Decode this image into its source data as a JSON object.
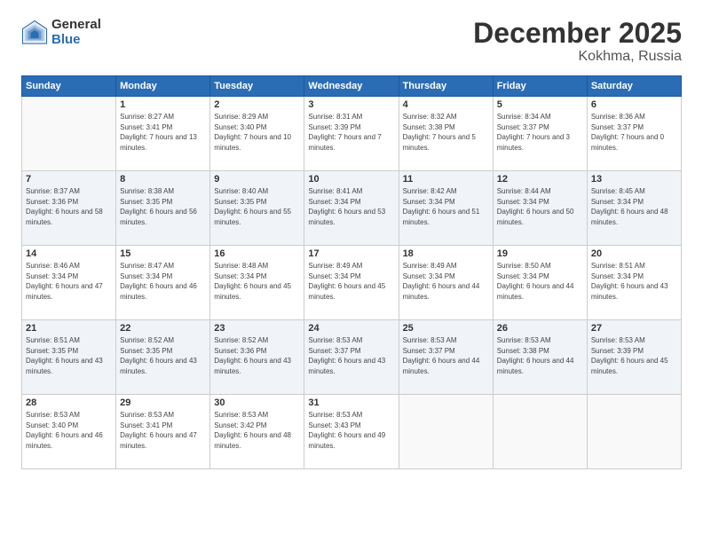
{
  "logo": {
    "general": "General",
    "blue": "Blue"
  },
  "title": "December 2025",
  "location": "Kokhma, Russia",
  "days_header": [
    "Sunday",
    "Monday",
    "Tuesday",
    "Wednesday",
    "Thursday",
    "Friday",
    "Saturday"
  ],
  "weeks": [
    [
      {
        "day": "",
        "sunrise": "",
        "sunset": "",
        "daylight": "",
        "empty": true
      },
      {
        "day": "1",
        "sunrise": "Sunrise: 8:27 AM",
        "sunset": "Sunset: 3:41 PM",
        "daylight": "Daylight: 7 hours and 13 minutes."
      },
      {
        "day": "2",
        "sunrise": "Sunrise: 8:29 AM",
        "sunset": "Sunset: 3:40 PM",
        "daylight": "Daylight: 7 hours and 10 minutes."
      },
      {
        "day": "3",
        "sunrise": "Sunrise: 8:31 AM",
        "sunset": "Sunset: 3:39 PM",
        "daylight": "Daylight: 7 hours and 7 minutes."
      },
      {
        "day": "4",
        "sunrise": "Sunrise: 8:32 AM",
        "sunset": "Sunset: 3:38 PM",
        "daylight": "Daylight: 7 hours and 5 minutes."
      },
      {
        "day": "5",
        "sunrise": "Sunrise: 8:34 AM",
        "sunset": "Sunset: 3:37 PM",
        "daylight": "Daylight: 7 hours and 3 minutes."
      },
      {
        "day": "6",
        "sunrise": "Sunrise: 8:36 AM",
        "sunset": "Sunset: 3:37 PM",
        "daylight": "Daylight: 7 hours and 0 minutes."
      }
    ],
    [
      {
        "day": "7",
        "sunrise": "Sunrise: 8:37 AM",
        "sunset": "Sunset: 3:36 PM",
        "daylight": "Daylight: 6 hours and 58 minutes."
      },
      {
        "day": "8",
        "sunrise": "Sunrise: 8:38 AM",
        "sunset": "Sunset: 3:35 PM",
        "daylight": "Daylight: 6 hours and 56 minutes."
      },
      {
        "day": "9",
        "sunrise": "Sunrise: 8:40 AM",
        "sunset": "Sunset: 3:35 PM",
        "daylight": "Daylight: 6 hours and 55 minutes."
      },
      {
        "day": "10",
        "sunrise": "Sunrise: 8:41 AM",
        "sunset": "Sunset: 3:34 PM",
        "daylight": "Daylight: 6 hours and 53 minutes."
      },
      {
        "day": "11",
        "sunrise": "Sunrise: 8:42 AM",
        "sunset": "Sunset: 3:34 PM",
        "daylight": "Daylight: 6 hours and 51 minutes."
      },
      {
        "day": "12",
        "sunrise": "Sunrise: 8:44 AM",
        "sunset": "Sunset: 3:34 PM",
        "daylight": "Daylight: 6 hours and 50 minutes."
      },
      {
        "day": "13",
        "sunrise": "Sunrise: 8:45 AM",
        "sunset": "Sunset: 3:34 PM",
        "daylight": "Daylight: 6 hours and 48 minutes."
      }
    ],
    [
      {
        "day": "14",
        "sunrise": "Sunrise: 8:46 AM",
        "sunset": "Sunset: 3:34 PM",
        "daylight": "Daylight: 6 hours and 47 minutes."
      },
      {
        "day": "15",
        "sunrise": "Sunrise: 8:47 AM",
        "sunset": "Sunset: 3:34 PM",
        "daylight": "Daylight: 6 hours and 46 minutes."
      },
      {
        "day": "16",
        "sunrise": "Sunrise: 8:48 AM",
        "sunset": "Sunset: 3:34 PM",
        "daylight": "Daylight: 6 hours and 45 minutes."
      },
      {
        "day": "17",
        "sunrise": "Sunrise: 8:49 AM",
        "sunset": "Sunset: 3:34 PM",
        "daylight": "Daylight: 6 hours and 45 minutes."
      },
      {
        "day": "18",
        "sunrise": "Sunrise: 8:49 AM",
        "sunset": "Sunset: 3:34 PM",
        "daylight": "Daylight: 6 hours and 44 minutes."
      },
      {
        "day": "19",
        "sunrise": "Sunrise: 8:50 AM",
        "sunset": "Sunset: 3:34 PM",
        "daylight": "Daylight: 6 hours and 44 minutes."
      },
      {
        "day": "20",
        "sunrise": "Sunrise: 8:51 AM",
        "sunset": "Sunset: 3:34 PM",
        "daylight": "Daylight: 6 hours and 43 minutes."
      }
    ],
    [
      {
        "day": "21",
        "sunrise": "Sunrise: 8:51 AM",
        "sunset": "Sunset: 3:35 PM",
        "daylight": "Daylight: 6 hours and 43 minutes."
      },
      {
        "day": "22",
        "sunrise": "Sunrise: 8:52 AM",
        "sunset": "Sunset: 3:35 PM",
        "daylight": "Daylight: 6 hours and 43 minutes."
      },
      {
        "day": "23",
        "sunrise": "Sunrise: 8:52 AM",
        "sunset": "Sunset: 3:36 PM",
        "daylight": "Daylight: 6 hours and 43 minutes."
      },
      {
        "day": "24",
        "sunrise": "Sunrise: 8:53 AM",
        "sunset": "Sunset: 3:37 PM",
        "daylight": "Daylight: 6 hours and 43 minutes."
      },
      {
        "day": "25",
        "sunrise": "Sunrise: 8:53 AM",
        "sunset": "Sunset: 3:37 PM",
        "daylight": "Daylight: 6 hours and 44 minutes."
      },
      {
        "day": "26",
        "sunrise": "Sunrise: 8:53 AM",
        "sunset": "Sunset: 3:38 PM",
        "daylight": "Daylight: 6 hours and 44 minutes."
      },
      {
        "day": "27",
        "sunrise": "Sunrise: 8:53 AM",
        "sunset": "Sunset: 3:39 PM",
        "daylight": "Daylight: 6 hours and 45 minutes."
      }
    ],
    [
      {
        "day": "28",
        "sunrise": "Sunrise: 8:53 AM",
        "sunset": "Sunset: 3:40 PM",
        "daylight": "Daylight: 6 hours and 46 minutes."
      },
      {
        "day": "29",
        "sunrise": "Sunrise: 8:53 AM",
        "sunset": "Sunset: 3:41 PM",
        "daylight": "Daylight: 6 hours and 47 minutes."
      },
      {
        "day": "30",
        "sunrise": "Sunrise: 8:53 AM",
        "sunset": "Sunset: 3:42 PM",
        "daylight": "Daylight: 6 hours and 48 minutes."
      },
      {
        "day": "31",
        "sunrise": "Sunrise: 8:53 AM",
        "sunset": "Sunset: 3:43 PM",
        "daylight": "Daylight: 6 hours and 49 minutes."
      },
      {
        "day": "",
        "sunrise": "",
        "sunset": "",
        "daylight": "",
        "empty": true
      },
      {
        "day": "",
        "sunrise": "",
        "sunset": "",
        "daylight": "",
        "empty": true
      },
      {
        "day": "",
        "sunrise": "",
        "sunset": "",
        "daylight": "",
        "empty": true
      }
    ]
  ]
}
